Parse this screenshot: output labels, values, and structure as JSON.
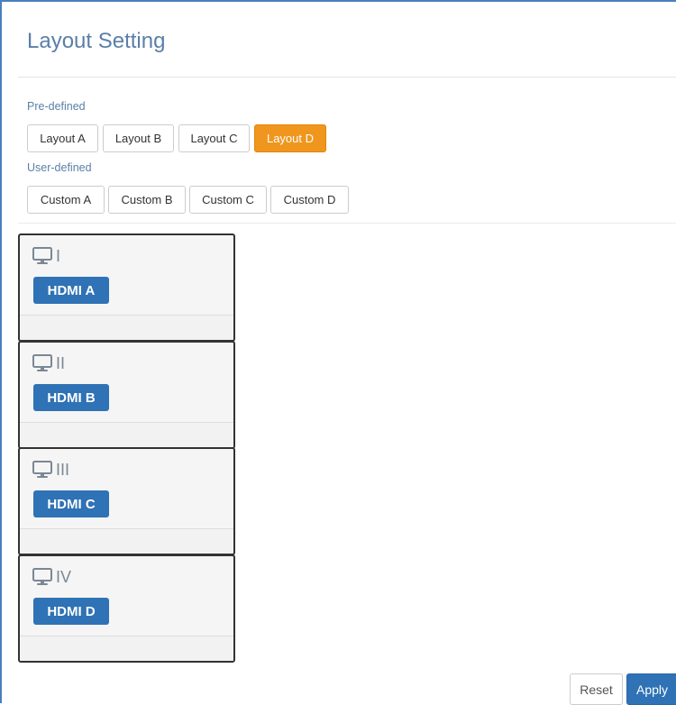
{
  "title": "Layout Setting",
  "predefined": {
    "label": "Pre-defined",
    "buttons": [
      "Layout A",
      "Layout B",
      "Layout C",
      "Layout D"
    ],
    "selected": "Layout D"
  },
  "userdefined": {
    "label": "User-defined",
    "buttons": [
      "Custom A",
      "Custom B",
      "Custom C",
      "Custom D"
    ]
  },
  "windows": [
    {
      "number": "I",
      "source": "HDMI A",
      "icon": "monitor-icon"
    },
    {
      "number": "II",
      "source": "HDMI B",
      "icon": "monitor-icon"
    },
    {
      "number": "III",
      "source": "HDMI C",
      "icon": "monitor-icon"
    },
    {
      "number": "IV",
      "source": "HDMI D",
      "icon": "monitor-icon"
    }
  ],
  "actions": {
    "reset": "Reset",
    "apply": "Apply"
  },
  "colors": {
    "accent": "#f0961e",
    "primary": "#2f72b5",
    "title": "#5a7fa8"
  }
}
